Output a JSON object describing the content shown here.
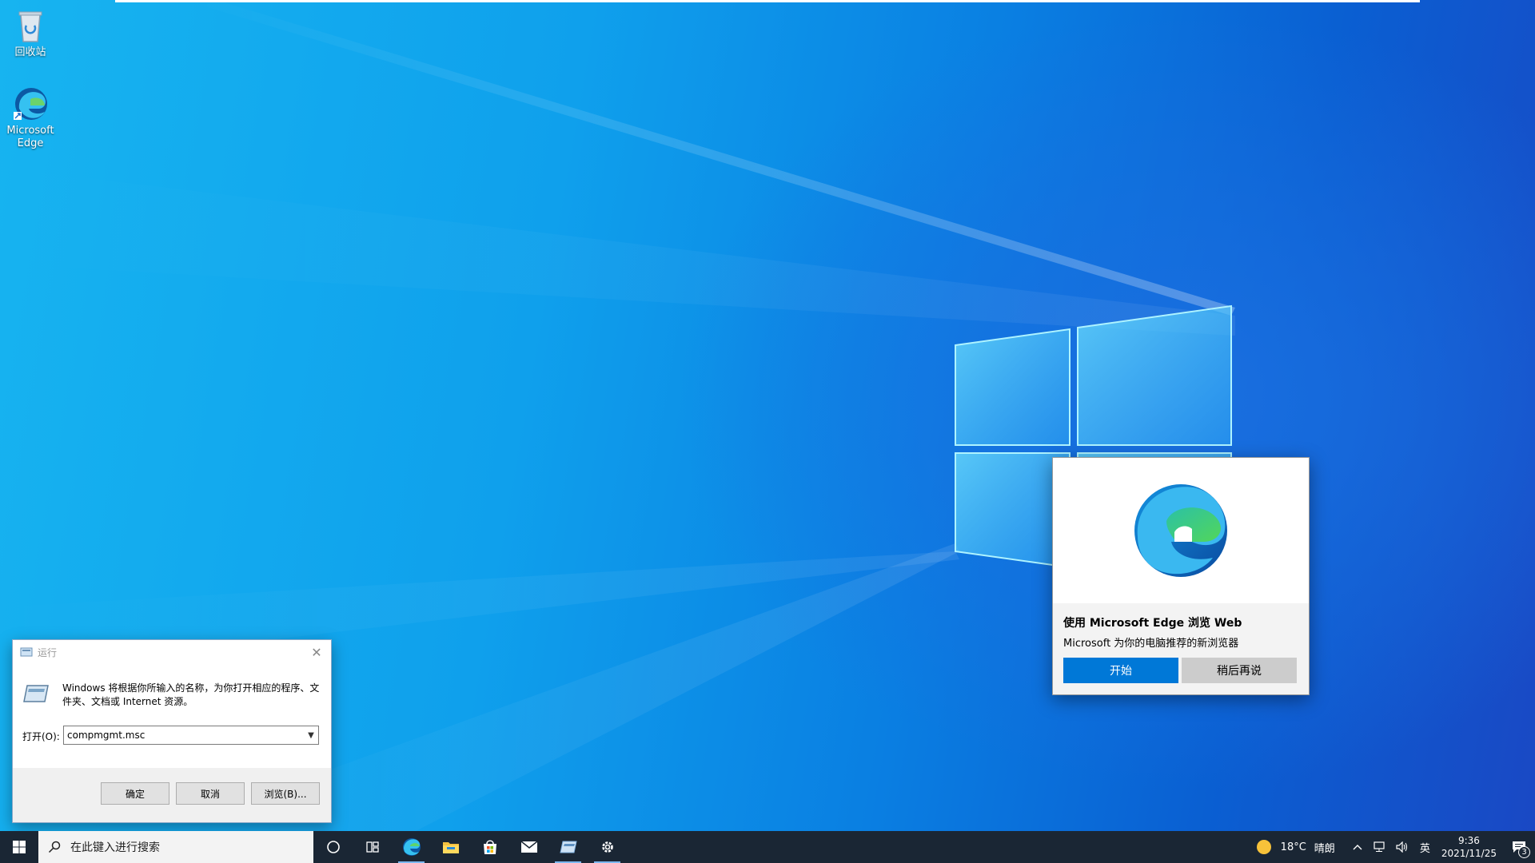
{
  "desktop": {
    "icons": [
      {
        "label": "回收站",
        "icon": "recycle-bin-icon"
      },
      {
        "label": "Microsoft Edge",
        "icon": "edge-icon"
      }
    ]
  },
  "run_dialog": {
    "title": "运行",
    "description": "Windows 将根据你所输入的名称，为你打开相应的程序、文件夹、文档或 Internet 资源。",
    "open_label": "打开(O):",
    "open_value": "compmgmt.msc",
    "ok": "确定",
    "cancel": "取消",
    "browse": "浏览(B)..."
  },
  "edge_toast": {
    "title": "使用 Microsoft Edge 浏览 Web",
    "subtitle": "Microsoft 为你的电脑推荐的新浏览器",
    "primary": "开始",
    "secondary": "稍后再说"
  },
  "taskbar": {
    "search_placeholder": "在此键入进行搜索",
    "items": [
      "cortana-icon",
      "task-view-icon",
      "edge-icon",
      "file-explorer-icon",
      "store-icon",
      "mail-icon",
      "run-icon",
      "settings-icon"
    ],
    "weather": {
      "temp": "18°C",
      "condition": "晴朗"
    },
    "ime": "英",
    "time": "9:36",
    "date": "2021/11/25",
    "notifications": "3"
  },
  "colors": {
    "accent": "#0078d7",
    "taskbar": "#1a2634"
  }
}
